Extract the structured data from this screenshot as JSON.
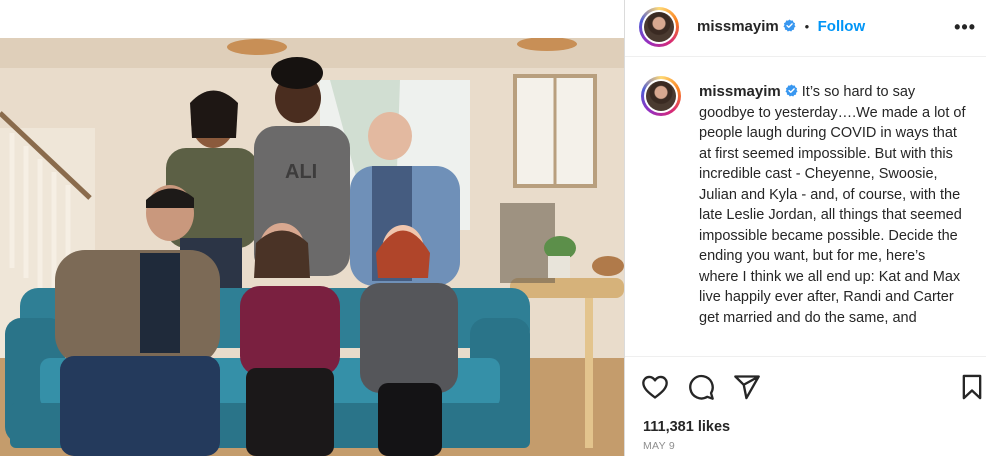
{
  "post": {
    "username": "missmayim",
    "follow_label": "Follow",
    "separator": "•",
    "more_label": "•••",
    "caption": "It’s so hard to say goodbye to yesterday….We made a lot of people laugh during COVID in ways that at first seemed impossible. But with this incredible cast - Cheyenne, Swoosie, Julian and Kyla - and, of course, with the late Leslie Jordan, all things that seemed impossible became possible. Decide the ending you want, but for me, here’s where I think we all end up: Kat and Max live happily ever after, Randi and Carter get married and do the same, and",
    "likes": "111,381 likes",
    "date": "MAY 9"
  },
  "icons": {
    "like": "heart-icon",
    "comment": "comment-icon",
    "share": "share-icon",
    "save": "bookmark-icon",
    "verified": "verified-badge-icon",
    "more": "more-options-icon"
  },
  "colors": {
    "link_blue": "#0095f6",
    "verified_blue": "#3897f0",
    "text": "#262626",
    "muted": "#8e8e8e",
    "border": "#dbdbdb"
  }
}
